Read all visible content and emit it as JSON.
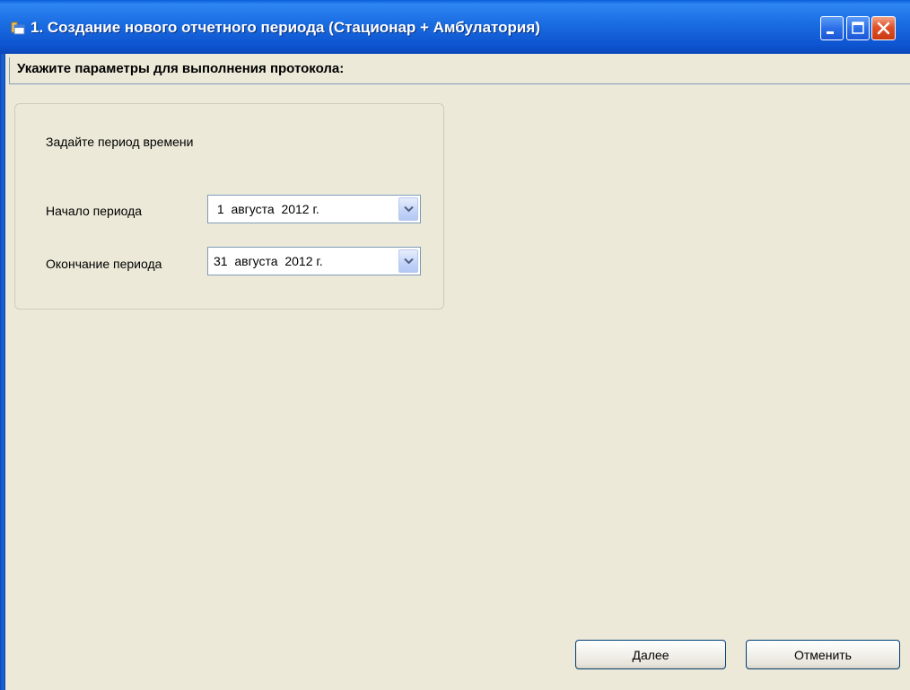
{
  "window": {
    "title": "1. Создание нового отчетного периода (Стационар + Амбулатория)",
    "icons": {
      "app": "app-window-icon",
      "minimize": "minimize-icon",
      "maximize": "maximize-icon",
      "close": "close-icon"
    }
  },
  "header": {
    "text": "Укажите параметры для выполнения протокола:"
  },
  "period_group": {
    "caption": "Задайте период времени",
    "start": {
      "label": "Начало периода",
      "value": " 1  августа  2012 г."
    },
    "end": {
      "label": "Окончание периода",
      "value": "31  августа  2012 г."
    },
    "dropdown_icon": "chevron-down-icon"
  },
  "buttons": {
    "next": "Далее",
    "cancel": "Отменить"
  },
  "colors": {
    "titlebar": "#1c6fe3",
    "window_bg": "#ece9d8",
    "close_button": "#e0512a"
  }
}
